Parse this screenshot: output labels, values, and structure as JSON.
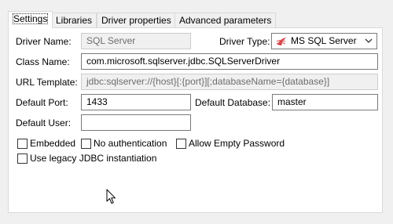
{
  "tabs": [
    {
      "label": "Settings"
    },
    {
      "label": "Libraries"
    },
    {
      "label": "Driver properties"
    },
    {
      "label": "Advanced parameters"
    }
  ],
  "form": {
    "driver_name_label": "Driver Name:",
    "driver_name_value": "SQL Server",
    "driver_type_label": "Driver Type:",
    "driver_type_value": "MS SQL Server",
    "class_name_label": "Class Name:",
    "class_name_value": "com.microsoft.sqlserver.jdbc.SQLServerDriver",
    "url_template_label": "URL Template:",
    "url_template_value": "jdbc:sqlserver://{host}[:{port}][;databaseName={database}]",
    "default_port_label": "Default Port:",
    "default_port_value": "1433",
    "default_database_label": "Default Database:",
    "default_database_value": "master",
    "default_user_label": "Default User:",
    "default_user_value": ""
  },
  "options": {
    "embedded": {
      "label": "Embedded",
      "checked": false
    },
    "no_auth": {
      "label": "No authentication",
      "checked": false
    },
    "allow_empty_password": {
      "label": "Allow Empty Password",
      "checked": false
    },
    "legacy_jdbc": {
      "label": "Use legacy JDBC instantiation",
      "checked": false
    }
  },
  "icons": {
    "driver_type_icon": "ms-sql-server-icon",
    "dropdown_icon": "chevron-down-icon"
  },
  "colors": {
    "panel_bg": "#ffffff",
    "window_bg": "#f0f0f0",
    "sql_server_icon_red": "#d13438"
  }
}
